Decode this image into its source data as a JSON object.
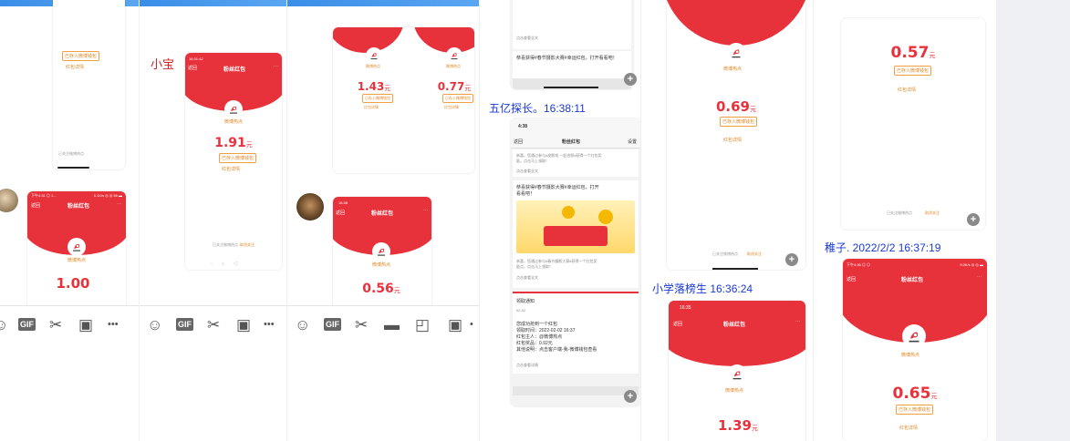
{
  "labels": {
    "xiaobao": "小宝",
    "wuyi": "五亿探长。16:38:11",
    "xiaoxue": "小学落榜生  16:36:24",
    "zhizi": "稚子. 2022/2/2 16:37:19"
  },
  "red_packet": {
    "title": "粉丝红包",
    "back": "返回",
    "sender": "微博热点",
    "yuan": "元",
    "deposited": "已存入微博钱包",
    "detail": "红包详情",
    "follow_note": "已关注微博热点",
    "cancel_follow": "取消关注",
    "settings": "设置"
  },
  "amounts": {
    "p1_bottom": "1.00",
    "p2": "1.91",
    "p3_left": "1.43",
    "p3_right": "0.77",
    "p3_bottom": "0.56",
    "p5_top": "0.69",
    "p5_bottom": "1.39",
    "p6_top": "0.57",
    "p6_bottom": "0.65"
  },
  "status": {
    "p1": "下午4:31 ◎ 1... ",
    "p1_right": "0.1K/s ◎ ◎ 56 ▬",
    "p2": "16:31:42",
    "p3": "16:38",
    "p4": "4:38",
    "p5": "16:35",
    "p6": "下午4:36 ◎ ◎",
    "p6_right": "9.0K/s ◎ ◎ ▬"
  },
  "chat": {
    "view_full": "点击查看全文",
    "msg1": "恭喜获得#春节摄影大赛#幸运红包，打开看看吧！",
    "msg1_line1": "恭喜获得#春节摄影大赛#幸运红包，打开",
    "msg1_line2": "看看吧！",
    "msg_gray1": "恭喜。您通过参与#皮影戏 一起合照#获得一个红包奖",
    "msg_gray2": "励，点击马上领取！",
    "msg_gray3": "恭喜，您通过参与#春节摄影大赛#获得一个红包奖",
    "msg_gray4": "励点，点击马上领取！",
    "notify_title": "领取通知",
    "notify_date": "02-02",
    "notify_1": "您成功抢到一个红包",
    "notify_2": "领取时间：2022-02-02 16:37",
    "notify_3": "红包主人：@微博热点",
    "notify_4": "红包奖品：0.92元",
    "notify_5": "其他说明：点击客户端-我-微博钱包查看",
    "view_detail": "点击查看详情"
  },
  "toolbar": {
    "gif": "GIF",
    "more": "•••"
  },
  "icons": [
    "smile-icon",
    "gif-icon",
    "scissors-icon",
    "image-icon",
    "more-icon",
    "folder-icon",
    "crop-icon",
    "zoom-icon",
    "redpacket-logo-icon"
  ],
  "colors": {
    "red": "#e8323b",
    "orange": "#e08a2a",
    "blue_label": "#1a3ad4"
  }
}
